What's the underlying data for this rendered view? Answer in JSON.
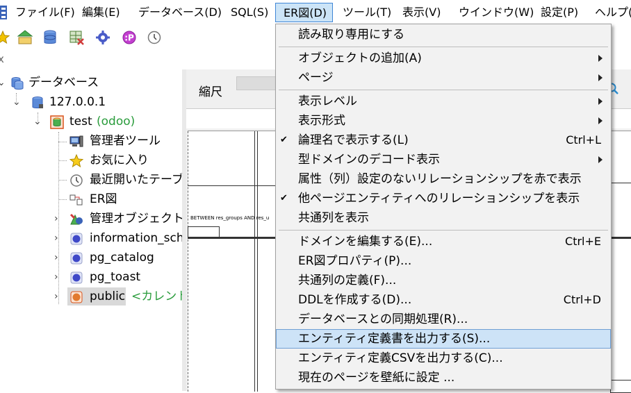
{
  "menubar": {
    "items": [
      {
        "label": "ファイル(F)"
      },
      {
        "label": "編集(E)"
      },
      {
        "label": "データベース(D)"
      },
      {
        "label": "SQL(S)"
      },
      {
        "label": "ER図(D)"
      },
      {
        "label": "ツール(T)"
      },
      {
        "label": "表示(V)"
      },
      {
        "label": "ウインドウ(W)"
      },
      {
        "label": "設定(P)"
      },
      {
        "label": "ヘルプ("
      }
    ]
  },
  "tree": {
    "root": "データベース",
    "server": "127.0.0.1",
    "db": {
      "name": "test",
      "tag": "(odoo)"
    },
    "children": [
      {
        "label": "管理者ツール"
      },
      {
        "label": "お気に入り"
      },
      {
        "label": "最近開いたテーブ"
      },
      {
        "label": "ER図"
      },
      {
        "label": "管理オブジェクト"
      },
      {
        "label": "information_sche"
      },
      {
        "label": "pg_catalog"
      },
      {
        "label": "pg_toast"
      },
      {
        "label": "public"
      }
    ],
    "current_tag": "<カレント;"
  },
  "panel": {
    "scale_label": "縮尺",
    "canvas_text": "BETWEEN res_groups AND res_u"
  },
  "er_menu": {
    "items": [
      {
        "label": "読み取り専用にする"
      },
      {
        "label": "オブジェクトの追加(A)"
      },
      {
        "label": "ページ"
      },
      {
        "label": "表示レベル"
      },
      {
        "label": "表示形式"
      },
      {
        "label": "論理名で表示する(L)",
        "shortcut": "Ctrl+L"
      },
      {
        "label": "型ドメインのデコード表示"
      },
      {
        "label": "属性（列）設定のないリレーションシップを赤で表示"
      },
      {
        "label": "他ページエンティティへのリレーションシップを表示"
      },
      {
        "label": "共通列を表示"
      },
      {
        "label": "ドメインを編集する(E)...",
        "shortcut": "Ctrl+E"
      },
      {
        "label": "ER図プロパティ(P)..."
      },
      {
        "label": "共通列の定義(F)..."
      },
      {
        "label": "DDLを作成する(D)...",
        "shortcut": "Ctrl+D"
      },
      {
        "label": "データベースとの同期処理(R)..."
      },
      {
        "label": "エンティティ定義書を出力する(S)..."
      },
      {
        "label": "エンティティ定義CSVを出力する(C)..."
      },
      {
        "label": "現在のページを壁紙に設定 ..."
      }
    ]
  }
}
